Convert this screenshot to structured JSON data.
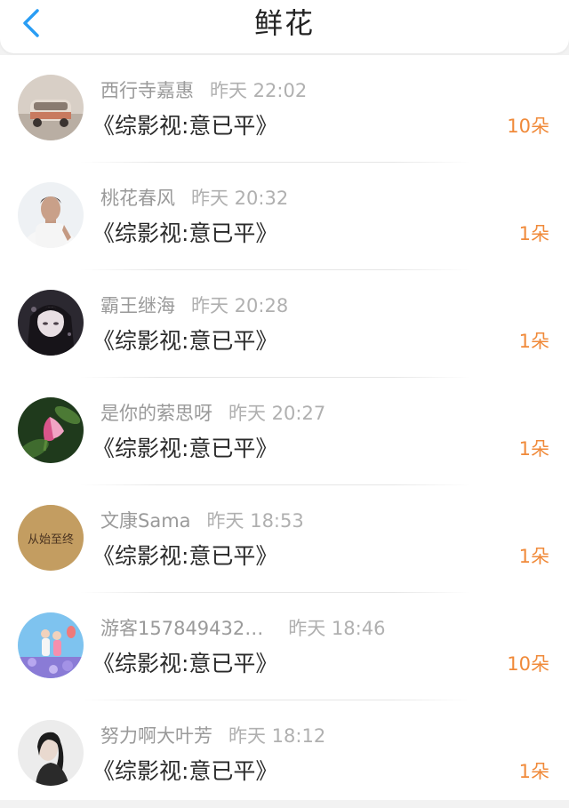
{
  "header": {
    "title": "鲜花",
    "back_icon": "chevron-left-icon",
    "accent_color": "#2a9df4"
  },
  "count_color": "#f08a3a",
  "items": [
    {
      "name": "西行寺嘉惠",
      "time": "昨天 22:02",
      "book": "《综影视:意已平》",
      "count": "10朵"
    },
    {
      "name": "桃花春风",
      "time": "昨天 20:32",
      "book": "《综影视:意已平》",
      "count": "1朵"
    },
    {
      "name": "霸王继海",
      "time": "昨天 20:28",
      "book": "《综影视:意已平》",
      "count": "1朵"
    },
    {
      "name": "是你的萦思呀",
      "time": "昨天 20:27",
      "book": "《综影视:意已平》",
      "count": "1朵"
    },
    {
      "name": "文康Sama",
      "time": "昨天 18:53",
      "book": "《综影视:意已平》",
      "count": "1朵",
      "avatar_text": "从始至终"
    },
    {
      "name": "游客157849432…",
      "time": "昨天 18:46",
      "book": "《综影视:意已平》",
      "count": "10朵"
    },
    {
      "name": "努力啊大叶芳",
      "time": "昨天 18:12",
      "book": "《综影视:意已平》",
      "count": "1朵"
    }
  ]
}
